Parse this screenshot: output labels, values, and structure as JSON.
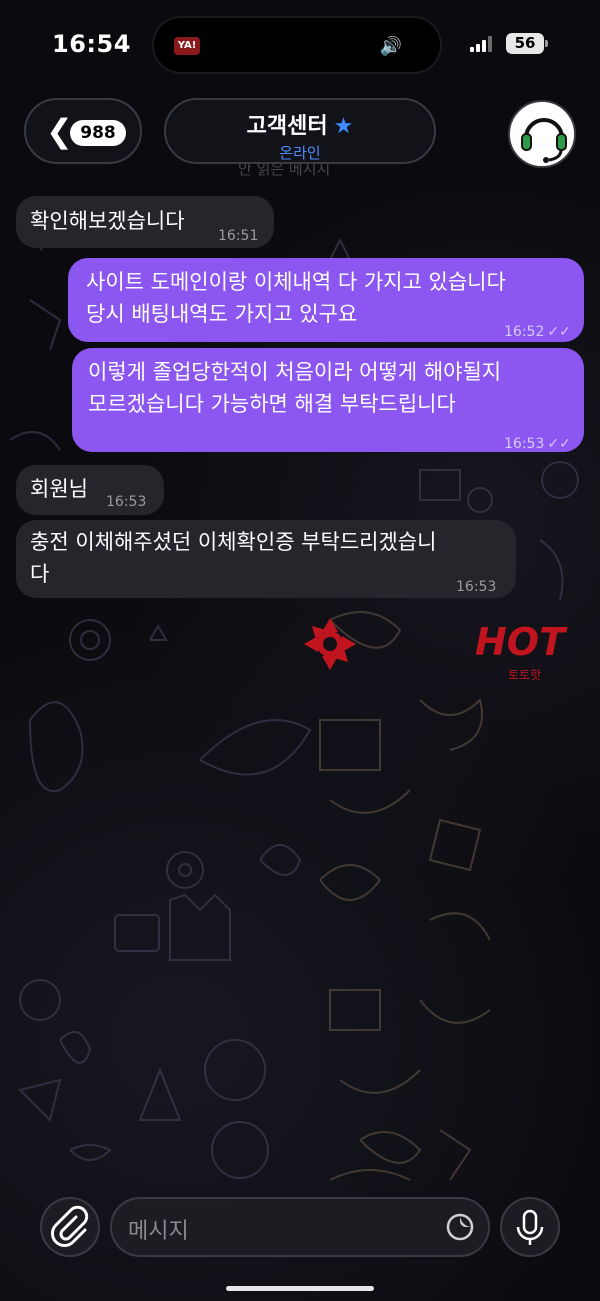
{
  "status_bar": {
    "time": "16:54",
    "battery": "56",
    "island_app": "YA!"
  },
  "header": {
    "back_count": "988",
    "title": "고객센터",
    "subtitle": "온라인",
    "behind_text": "안 읽은 메시지"
  },
  "messages": [
    {
      "dir": "in",
      "lines": [
        "확인해보겠습니다"
      ],
      "time": "16:51"
    },
    {
      "dir": "out",
      "lines": [
        "사이트 도메인이랑 이체내역 다 가지고 있습니다",
        "당시 배팅내역도 가지고 있구요"
      ],
      "time": "16:52",
      "read": true
    },
    {
      "dir": "out",
      "lines": [
        "이렇게 졸업당한적이 처음이라 어떻게 해야될지",
        "모르겠습니다 가능하면 해결 부탁드립니다"
      ],
      "time": "16:53",
      "read": true
    },
    {
      "dir": "in",
      "lines": [
        "회원님"
      ],
      "time": "16:53"
    },
    {
      "dir": "in",
      "lines": [
        "충전 이체해주셨던 이체확인증 부탁드리겠습니",
        "다"
      ],
      "time": "16:53"
    }
  ],
  "watermark": {
    "brand": "HOT",
    "sub": "토토핫"
  },
  "composer": {
    "placeholder": "메시지"
  },
  "colors": {
    "outgoing": "#8c56f0",
    "incoming": "#26252c",
    "accent": "#3d8bff"
  },
  "icons": [
    "back-chevron-icon",
    "star-icon",
    "headset-avatar-icon",
    "paperclip-icon",
    "sticker-icon",
    "mic-icon",
    "read-check-icon"
  ]
}
